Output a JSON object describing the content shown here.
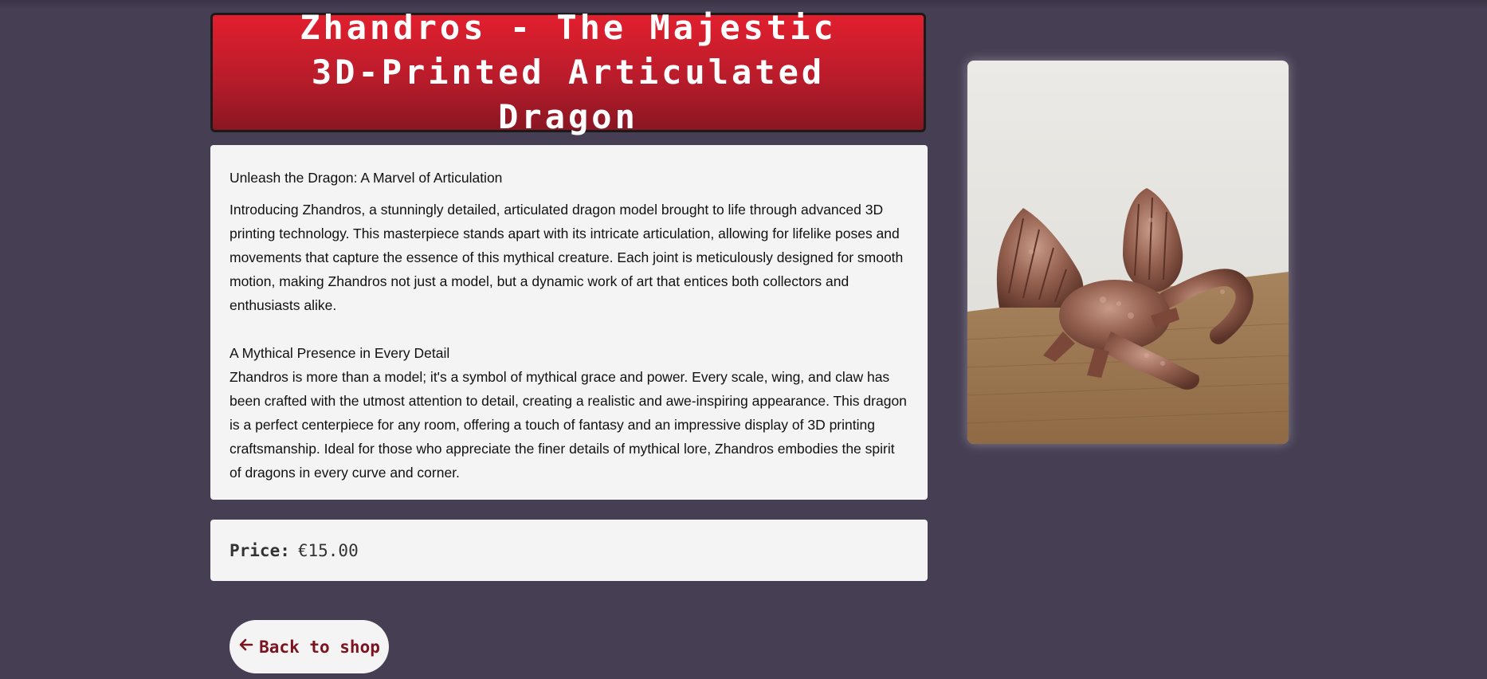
{
  "title": "Zhandros - The Majestic 3D-Printed Articulated Dragon",
  "description": {
    "heading1": "Unleash the Dragon: A Marvel of Articulation",
    "paragraph1": "Introducing Zhandros, a stunningly detailed, articulated dragon model brought to life through advanced 3D printing technology. This masterpiece stands apart with its intricate articulation, allowing for lifelike poses and movements that capture the essence of this mythical creature. Each joint is meticulously designed for smooth motion, making Zhandros not just a model, but a dynamic work of art that entices both collectors and enthusiasts alike.",
    "heading2": "A Mythical Presence in Every Detail",
    "paragraph2": "Zhandros is more than a model; it's a symbol of mythical grace and power. Every scale, wing, and claw has been crafted with the utmost attention to detail, creating a realistic and awe-inspiring appearance. This dragon is a perfect centerpiece for any room, offering a touch of fantasy and an impressive display of 3D printing craftsmanship. Ideal for those who appreciate the finer details of mythical lore, Zhandros embodies the spirit of dragons in every curve and corner."
  },
  "price": {
    "label": "Price:",
    "value": "€15.00"
  },
  "back_button": {
    "label": "Back to shop",
    "icon": "arrow-left-icon"
  },
  "product_image": {
    "subject": "bronze articulated dragon on wooden table"
  },
  "colors": {
    "background": "#463e52",
    "title_red": "#d81f2d",
    "panel": "#f4f4f4",
    "button_text": "#7a1520"
  }
}
